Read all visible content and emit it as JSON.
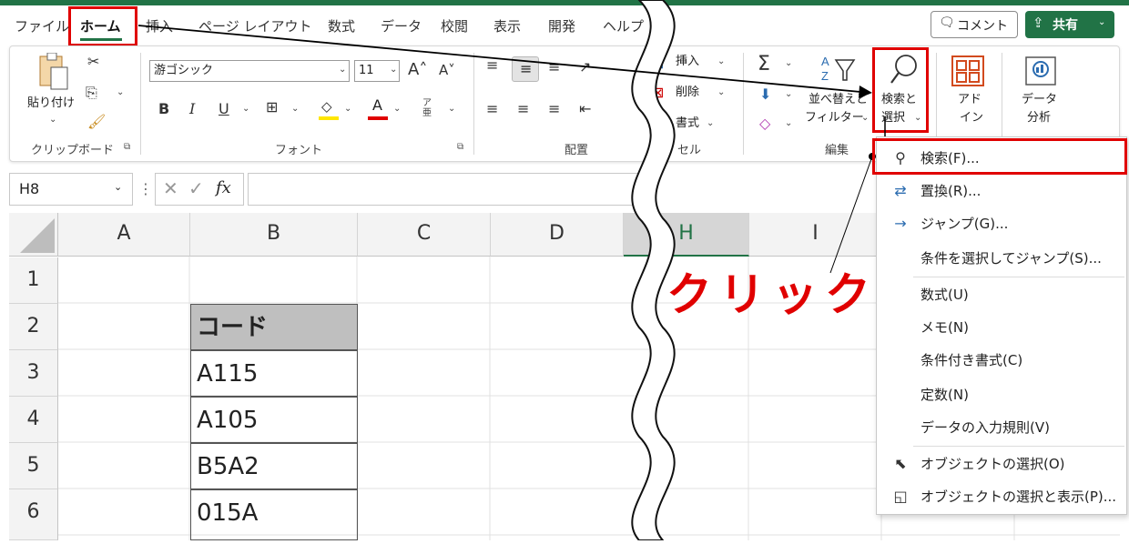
{
  "tabs": [
    "ファイル",
    "ホーム",
    "挿入",
    "ページ レイアウト",
    "数式",
    "データ",
    "校閲",
    "表示",
    "開発",
    "ヘルプ"
  ],
  "header": {
    "comment_label": "コメント",
    "share_label": "共有"
  },
  "ribbon": {
    "clipboard": {
      "paste_label": "貼り付け",
      "group_label": "クリップボード"
    },
    "font": {
      "font_name": "游ゴシック",
      "font_size": "11",
      "group_label": "フォント",
      "bold": "B",
      "italic": "I",
      "underline": "U",
      "font_color": "A",
      "phonetic": "ア亜"
    },
    "alignment": {
      "group_label": "配置"
    },
    "cells": {
      "insert_label": "挿入",
      "delete_label": "削除",
      "format_label": "書式",
      "group_label": "セル"
    },
    "editing": {
      "sort_label_1": "並べ替えと",
      "sort_label_2": "フィルター",
      "find_label_1": "検索と",
      "find_label_2": "選択",
      "group_label": "編集"
    },
    "addins": {
      "label_1": "アド",
      "label_2": "イン"
    },
    "analysis": {
      "label_1": "データ",
      "label_2": "分析"
    }
  },
  "formula_bar": {
    "name_box": "H8",
    "fx": "fx",
    "value": ""
  },
  "columns": [
    "A",
    "B",
    "C",
    "D",
    "H",
    "I"
  ],
  "rows": [
    "1",
    "2",
    "3",
    "4",
    "5",
    "6"
  ],
  "cells_b": [
    "",
    "コード",
    "A115",
    "A105",
    "B5A2",
    "015A"
  ],
  "find_menu": [
    {
      "icon": "search-icon",
      "label": "検索(F)..."
    },
    {
      "icon": "replace-icon",
      "label": "置換(R)..."
    },
    {
      "icon": "arrow-right-icon",
      "label": "ジャンプ(G)..."
    },
    {
      "icon": "",
      "label": "条件を選択してジャンプ(S)..."
    },
    {
      "icon": "",
      "label": "数式(U)"
    },
    {
      "icon": "",
      "label": "メモ(N)"
    },
    {
      "icon": "",
      "label": "条件付き書式(C)"
    },
    {
      "icon": "",
      "label": "定数(N)"
    },
    {
      "icon": "",
      "label": "データの入力規則(V)"
    },
    {
      "icon": "cursor-icon",
      "label": "オブジェクトの選択(O)"
    },
    {
      "icon": "selection-pane-icon",
      "label": "オブジェクトの選択と表示(P)..."
    }
  ],
  "annotation": {
    "click_text": "クリック"
  },
  "colors": {
    "accent": "#217346",
    "highlight": "#e00000",
    "header_gray": "#bfbfbf"
  }
}
